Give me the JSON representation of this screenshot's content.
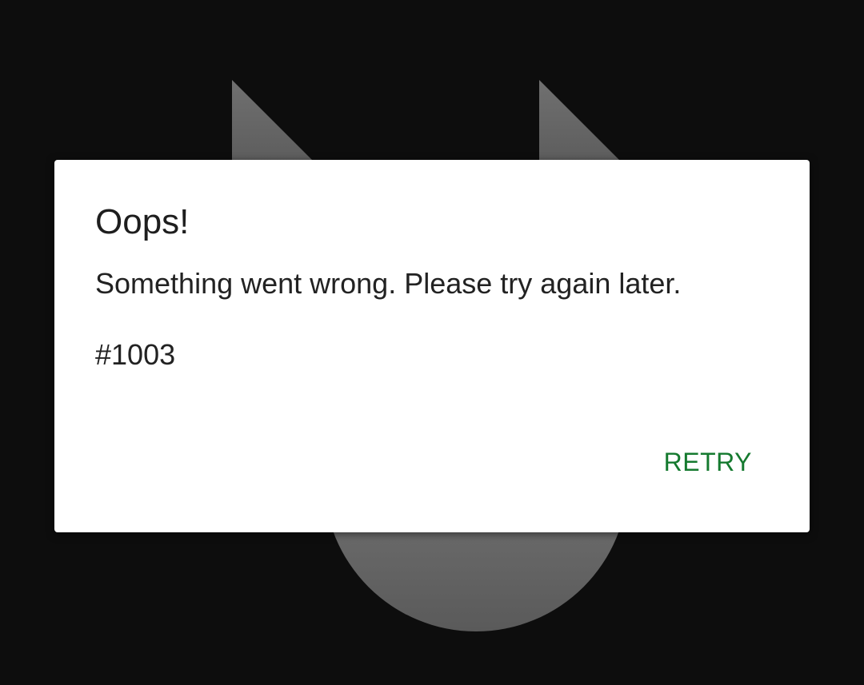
{
  "background": {
    "color": "#0d0d0d",
    "art_icon": "cat-silhouette",
    "art_color": "#666666"
  },
  "dialog": {
    "title": "Oops!",
    "message": "Something went wrong. Please try again later.",
    "error_code": "#1003",
    "retry_label": "RETRY",
    "accent_color": "#157a2f"
  }
}
